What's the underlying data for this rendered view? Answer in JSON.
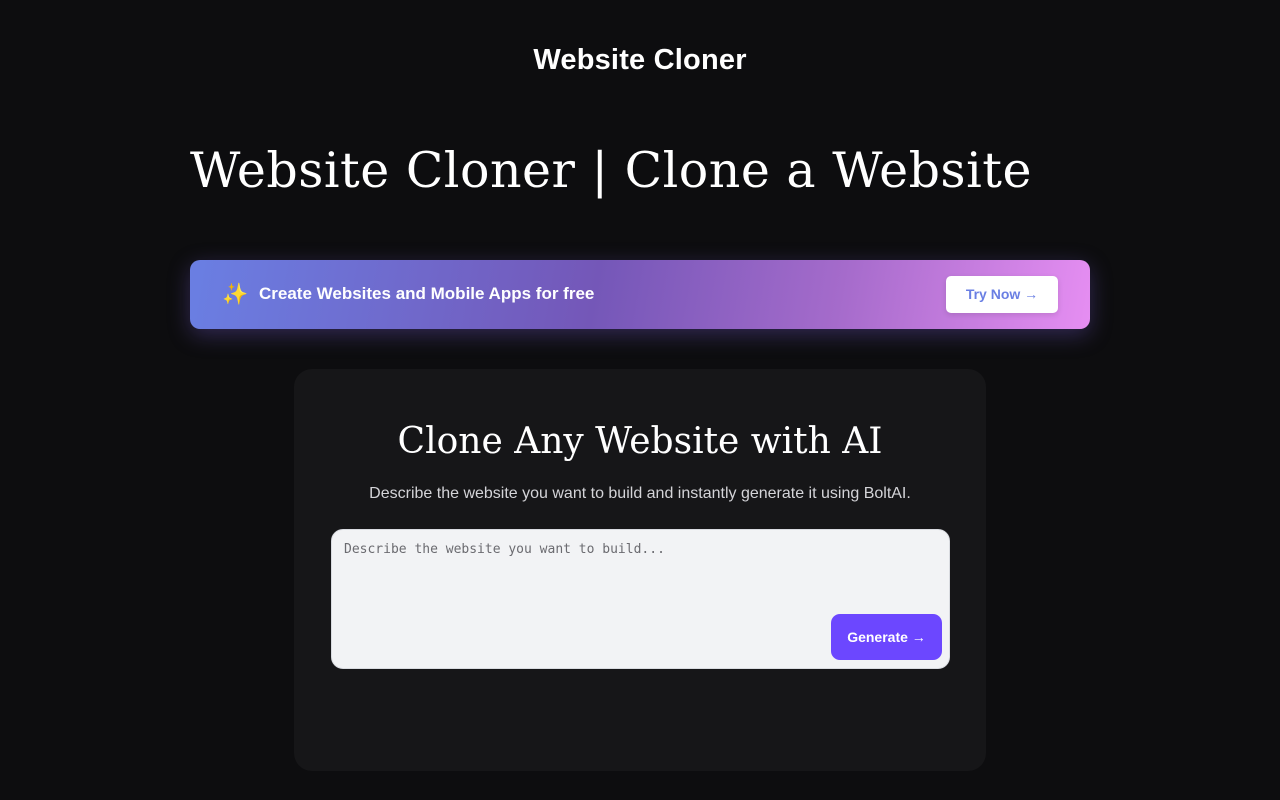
{
  "header": {
    "site_title": "Website Cloner"
  },
  "hero": {
    "title": "Website Cloner | Clone a Website"
  },
  "promo_banner": {
    "sparkle_glyph": "✨",
    "sparkle_icon": "sparkles-icon",
    "text": "Create Websites and Mobile Apps for free",
    "button_label": "Try Now →",
    "gradient_colors": [
      "#6a7fe3",
      "#7457b8",
      "#a56bcb",
      "#e68ef2"
    ]
  },
  "clone_card": {
    "title": "Clone Any Website with AI",
    "subtitle": "Describe the website you want to build and instantly generate it using BoltAI.",
    "prompt_placeholder": "Describe the website you want to build...",
    "generate_label": "Generate →",
    "accent_color": "#6c47ff"
  }
}
